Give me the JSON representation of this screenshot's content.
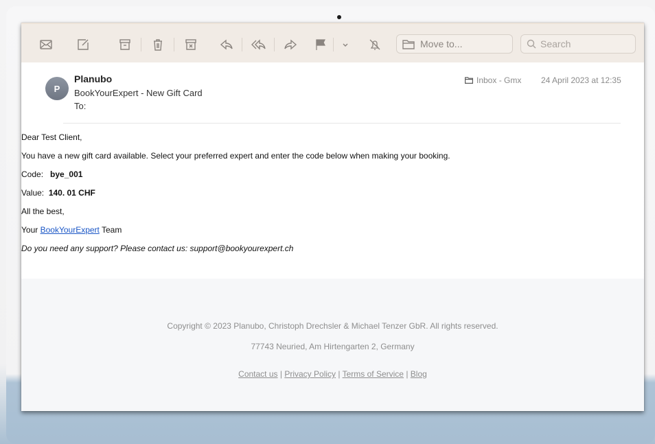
{
  "toolbar": {
    "icons": [
      "envelope-icon",
      "compose-icon",
      "archive-icon",
      "trash-icon",
      "junk-icon",
      "reply-icon",
      "reply-all-icon",
      "forward-icon",
      "flag-icon",
      "chevron-down-icon",
      "mute-icon"
    ],
    "move_to_label": "Move to...",
    "search_placeholder": "Search"
  },
  "header": {
    "avatar_initial": "P",
    "sender": "Planubo",
    "subject": "BookYourExpert - New Gift Card",
    "to_label": "To:",
    "mailbox": "Inbox - Gmx",
    "date": "24 April 2023 at 12:35"
  },
  "body": {
    "greeting": "Dear Test Client,",
    "intro": "You have a new gift card available. Select your preferred expert and enter the code below when making your booking.",
    "code_label": "Code:",
    "code_value": "bye_001",
    "value_label": "Value:",
    "value_value": "140. 01 CHF",
    "signoff": "All the best,",
    "your_prefix": "Your",
    "brand_link": "BookYourExpert",
    "team_suffix": "Team",
    "support": "Do you need any support? Please contact us: support@bookyourexpert.ch"
  },
  "footer": {
    "copyright": "Copyright © 2023 Planubo, Christoph Drechsler & Michael Tenzer GbR. All rights reserved.",
    "address": "77743 Neuried, Am Hirtengarten 2, Germany",
    "links": {
      "contact": "Contact us",
      "privacy": "Privacy Policy",
      "terms": "Terms of Service",
      "blog": "Blog",
      "separator": "|"
    }
  },
  "colors": {
    "toolbar_bg": "#f1ebe5",
    "link": "#1a56c6",
    "footer_bg": "#f6f7f9",
    "accent": "#2f62c8"
  }
}
